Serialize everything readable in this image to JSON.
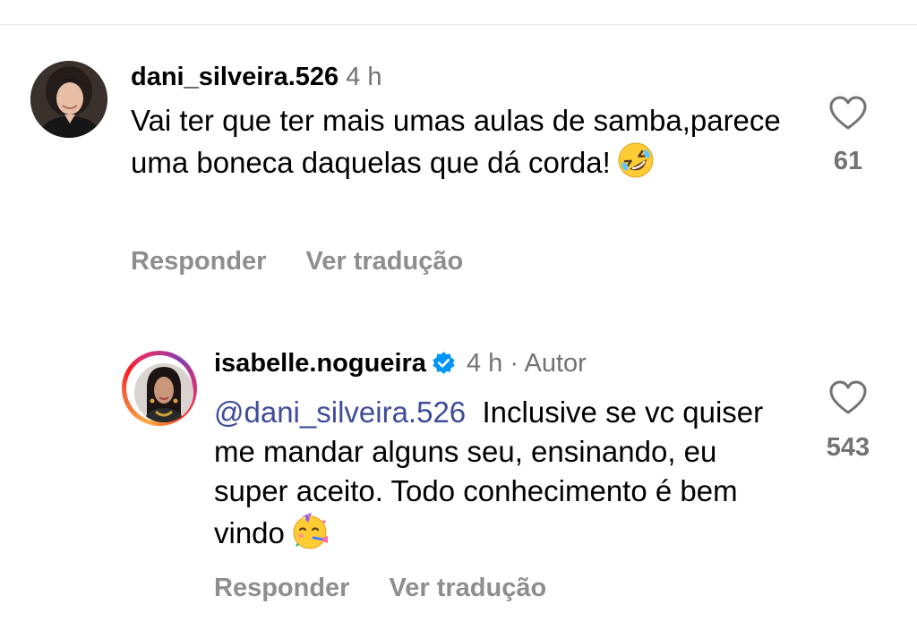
{
  "comments": [
    {
      "username": "dani_silveira.526",
      "time": "4 h",
      "text": "Vai ter que ter mais umas aulas de samba,parece uma boneca daquelas que dá corda!",
      "emoji": "rolling-on-floor-laughing-emoji",
      "likes": "61",
      "reply_label": "Responder",
      "translate_label": "Ver tradução",
      "verified": false
    },
    {
      "username": "isabelle.nogueira",
      "time": "4 h",
      "separator": "·",
      "author_label": "Autor",
      "mention": "@dani_silveira.526",
      "text": "Inclusive se vc quiser me mandar alguns seu, ensinando, eu super aceito. Todo conhecimento é bem vindo",
      "emoji": "partying-face-emoji",
      "likes": "543",
      "reply_label": "Responder",
      "translate_label": "Ver tradução",
      "verified": true
    }
  ],
  "colors": {
    "mention": "#3f4c9a",
    "muted": "#737373",
    "action": "#8e8e8e",
    "verified": "#0095f6",
    "story_ring": "#e1306c"
  }
}
